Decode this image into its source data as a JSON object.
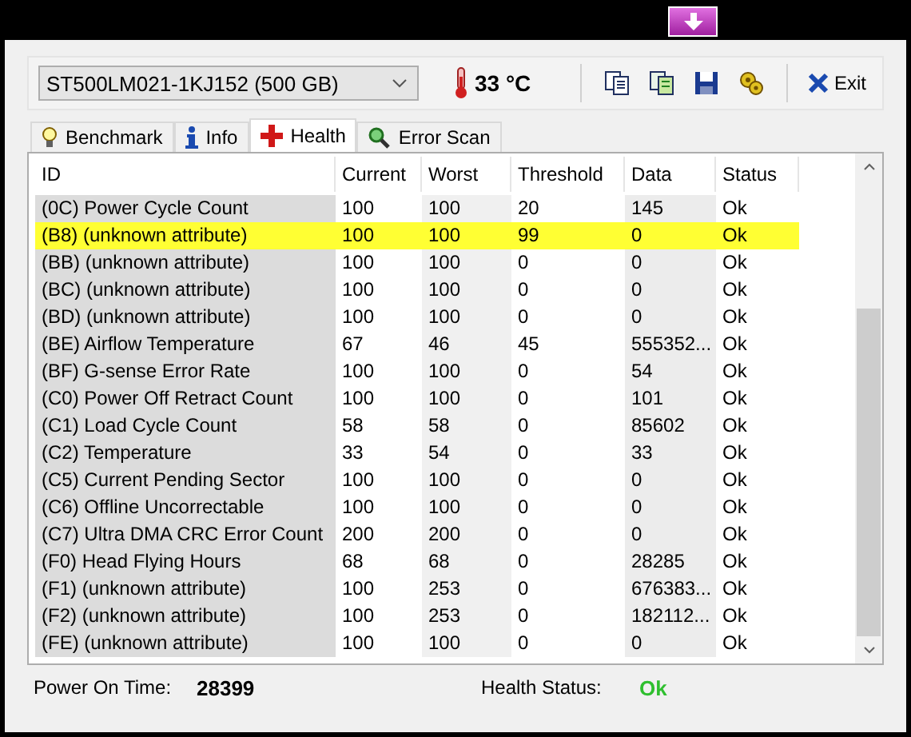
{
  "drive_select": {
    "value": "ST500LM021-1KJ152 (500 GB)"
  },
  "temperature": "33 °C",
  "exit_button": "Exit",
  "tabs": [
    {
      "label": "Benchmark",
      "selected": false
    },
    {
      "label": "Info",
      "selected": false
    },
    {
      "label": "Health",
      "selected": true
    },
    {
      "label": "Error Scan",
      "selected": false
    }
  ],
  "table": {
    "columns": [
      "ID",
      "Current",
      "Worst",
      "Threshold",
      "Data",
      "Status"
    ],
    "rows": [
      {
        "cells": [
          "(0C) Power Cycle Count",
          "100",
          "100",
          "20",
          "145",
          "Ok"
        ],
        "highlighted": false
      },
      {
        "cells": [
          "(B8) (unknown attribute)",
          "100",
          "100",
          "99",
          "0",
          "Ok"
        ],
        "highlighted": true
      },
      {
        "cells": [
          "(BB) (unknown attribute)",
          "100",
          "100",
          "0",
          "0",
          "Ok"
        ],
        "highlighted": false
      },
      {
        "cells": [
          "(BC) (unknown attribute)",
          "100",
          "100",
          "0",
          "0",
          "Ok"
        ],
        "highlighted": false
      },
      {
        "cells": [
          "(BD) (unknown attribute)",
          "100",
          "100",
          "0",
          "0",
          "Ok"
        ],
        "highlighted": false
      },
      {
        "cells": [
          "(BE) Airflow Temperature",
          "67",
          "46",
          "45",
          "555352...",
          "Ok"
        ],
        "highlighted": false
      },
      {
        "cells": [
          "(BF) G-sense Error Rate",
          "100",
          "100",
          "0",
          "54",
          "Ok"
        ],
        "highlighted": false
      },
      {
        "cells": [
          "(C0) Power Off Retract Count",
          "100",
          "100",
          "0",
          "101",
          "Ok"
        ],
        "highlighted": false
      },
      {
        "cells": [
          "(C1) Load Cycle Count",
          "58",
          "58",
          "0",
          "85602",
          "Ok"
        ],
        "highlighted": false
      },
      {
        "cells": [
          "(C2) Temperature",
          "33",
          "54",
          "0",
          "33",
          "Ok"
        ],
        "highlighted": false
      },
      {
        "cells": [
          "(C5) Current Pending Sector",
          "100",
          "100",
          "0",
          "0",
          "Ok"
        ],
        "highlighted": false
      },
      {
        "cells": [
          "(C6) Offline Uncorrectable",
          "100",
          "100",
          "0",
          "0",
          "Ok"
        ],
        "highlighted": false
      },
      {
        "cells": [
          "(C7) Ultra DMA CRC Error Count",
          "200",
          "200",
          "0",
          "0",
          "Ok"
        ],
        "highlighted": false
      },
      {
        "cells": [
          "(F0) Head Flying Hours",
          "68",
          "68",
          "0",
          "28285",
          "Ok"
        ],
        "highlighted": false
      },
      {
        "cells": [
          "(F1) (unknown attribute)",
          "100",
          "253",
          "0",
          "676383...",
          "Ok"
        ],
        "highlighted": false
      },
      {
        "cells": [
          "(F2) (unknown attribute)",
          "100",
          "253",
          "0",
          "182112...",
          "Ok"
        ],
        "highlighted": false
      },
      {
        "cells": [
          "(FE) (unknown attribute)",
          "100",
          "100",
          "0",
          "0",
          "Ok"
        ],
        "highlighted": false
      }
    ]
  },
  "footer": {
    "power_on_label": "Power On Time:",
    "power_on_value": "28399",
    "health_label": "Health Status:",
    "health_value": "Ok"
  }
}
